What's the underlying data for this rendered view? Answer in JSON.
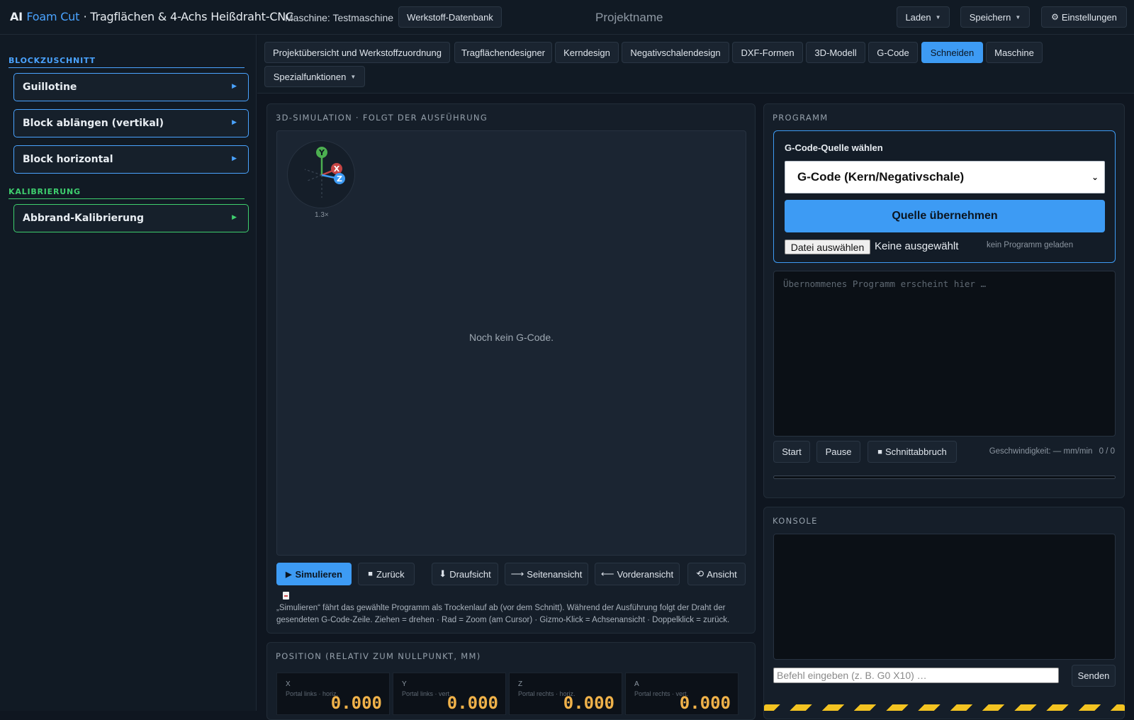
{
  "header": {
    "brand_ai": "AI",
    "brand_foam": "Foam Cut",
    "brand_sub": "· Tragflächen & 4-Achs Heißdraht-CNC",
    "machine_label": "Maschine: Testmaschine",
    "material_db_button": "Werkstoff-Datenbank",
    "project_name": "Projektname",
    "load_button": "Laden",
    "save_button": "Speichern",
    "settings_button": "Einstellungen",
    "accent_color": "#3d9bf4"
  },
  "sidebar": {
    "section1_title": "BLOCKZUSCHNITT",
    "section1_color": "#4aa3ff",
    "section1_items": [
      {
        "label": "Guillotine"
      },
      {
        "label": "Block ablängen (vertikal)"
      },
      {
        "label": "Block horizontal"
      }
    ],
    "section2_title": "KALIBRIERUNG",
    "section2_color": "#3ecf6e",
    "section2_items": [
      {
        "label": "Abbrand-Kalibrierung"
      }
    ]
  },
  "tabs": [
    {
      "label": "Projektübersicht und Werkstoffzuordnung",
      "active": false
    },
    {
      "label": "Tragflächendesigner",
      "active": false
    },
    {
      "label": "Kerndesign",
      "active": false
    },
    {
      "label": "Negativschalendesign",
      "active": false
    },
    {
      "label": "DXF-Formen",
      "active": false
    },
    {
      "label": "3D-Modell",
      "active": false
    },
    {
      "label": "G-Code",
      "active": false
    },
    {
      "label": "Schneiden",
      "active": true
    },
    {
      "label": "Maschine",
      "active": false
    },
    {
      "label": "Spezialfunktionen",
      "active": false
    }
  ],
  "simulation": {
    "title": "3D-SIMULATION · FOLGT DER AUSFÜHRUNG",
    "gizmo_y": "Y",
    "gizmo_x": "X",
    "gizmo_z": "Z",
    "zoom": "1.3×",
    "empty_text": "Noch kein G-Code.",
    "buttons": {
      "simulate": "Simulieren",
      "back": "Zurück",
      "top_view": "Draufsicht",
      "side_view": "Seitenansicht",
      "front_view": "Vorderansicht",
      "view": "Ansicht"
    },
    "help_text": "„Simulieren“ fährt das gewählte Programm als Trockenlauf ab (vor dem Schnitt). Während der Ausführung folgt der Draht der gesendeten G-Code-Zeile. Ziehen = drehen · Rad = Zoom (am Cursor) · Gizmo-Klick = Achsenansicht · Doppelklick = zurück."
  },
  "position": {
    "title": "POSITION (RELATIV ZUM NULLPUNKT, MM)",
    "axes": [
      {
        "axis": "X",
        "desc": "Portal links · horiz.",
        "value": "0.000"
      },
      {
        "axis": "Y",
        "desc": "Portal links · vert.",
        "value": "0.000"
      },
      {
        "axis": "Z",
        "desc": "Portal rechts · horiz.",
        "value": "0.000"
      },
      {
        "axis": "A",
        "desc": "Portal rechts · vert.",
        "value": "0.000"
      }
    ]
  },
  "program": {
    "title": "PROGRAMM",
    "source_label": "G-Code-Quelle wählen",
    "source_selected": "G-Code (Kern/Negativschale)",
    "apply_button": "Quelle übernehmen",
    "file_button": "Datei auswählen",
    "file_none": "Keine ausgewählt",
    "no_program": "kein Programm geladen",
    "textarea_placeholder": "Übernommenes Programm erscheint hier …",
    "start_button": "Start",
    "pause_button": "Pause",
    "abort_button": "Schnittabbruch",
    "speed_text": "Geschwindigkeit: — mm/min",
    "line_count": "0 / 0",
    "progress": 0
  },
  "console": {
    "title": "KONSOLE",
    "input_placeholder": "Befehl eingeben (z. B. G0 X10) …",
    "send_button": "Senden"
  }
}
